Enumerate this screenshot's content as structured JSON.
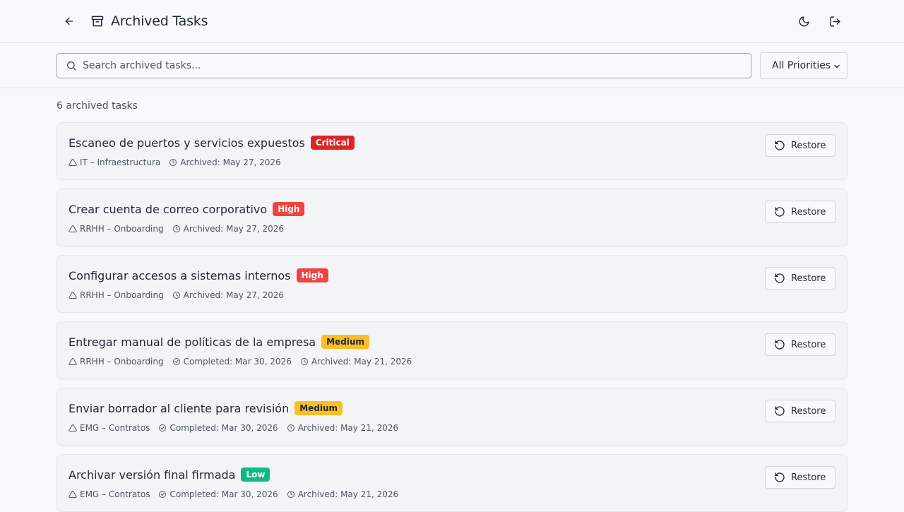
{
  "header": {
    "title": "Archived Tasks",
    "back_icon": "arrow-left-icon",
    "archive_icon": "archive-box-icon",
    "theme_icon": "moon-icon",
    "logout_icon": "log-out-icon"
  },
  "toolbar": {
    "search_placeholder": "Search archived tasks...",
    "search_value": "",
    "priority_filter": "All Priorities"
  },
  "count_label": "6 archived tasks",
  "colors": {
    "critical": "#dc2626",
    "high": "#ef4444",
    "medium": "#fbbf24",
    "low": "#10b981"
  },
  "tasks": [
    {
      "title": "Escaneo de puertos y servicios expuestos",
      "priority": "Critical",
      "project": "IT – Infraestructura",
      "completed": "",
      "archived": "Archived: May 27, 2026",
      "action": "Restore"
    },
    {
      "title": "Crear cuenta de correo corporativo",
      "priority": "High",
      "project": "RRHH – Onboarding",
      "completed": "",
      "archived": "Archived: May 27, 2026",
      "action": "Restore"
    },
    {
      "title": "Configurar accesos a sistemas internos",
      "priority": "High",
      "project": "RRHH – Onboarding",
      "completed": "",
      "archived": "Archived: May 27, 2026",
      "action": "Restore"
    },
    {
      "title": "Entregar manual de políticas de la empresa",
      "priority": "Medium",
      "project": "RRHH – Onboarding",
      "completed": "Completed: Mar 30, 2026",
      "archived": "Archived: May 21, 2026",
      "action": "Restore"
    },
    {
      "title": "Enviar borrador al cliente para revisión",
      "priority": "Medium",
      "project": "EMG – Contratos",
      "completed": "Completed: Mar 30, 2026",
      "archived": "Archived: May 21, 2026",
      "action": "Restore"
    },
    {
      "title": "Archivar versión final firmada",
      "priority": "Low",
      "project": "EMG – Contratos",
      "completed": "Completed: Mar 30, 2026",
      "archived": "Archived: May 21, 2026",
      "action": "Restore"
    }
  ]
}
